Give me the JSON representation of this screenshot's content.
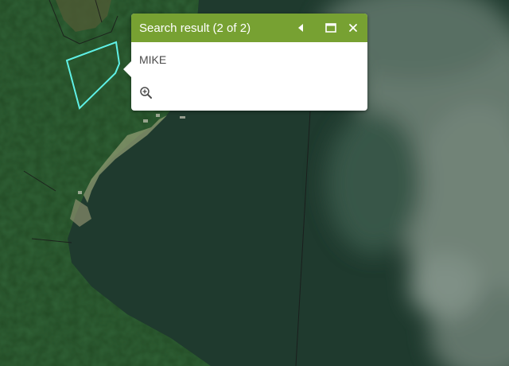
{
  "popup": {
    "title": "Search result (2 of 2)",
    "content": "MIKE",
    "previous_icon": "triangle-left-icon",
    "maximize_icon": "maximize-icon",
    "close_icon": "close-x-icon",
    "zoom_icon": "zoom-in-magnifier-icon",
    "header_color": "#77a132"
  },
  "map": {
    "basemap": "satellite imagery",
    "highlight_color": "#5ff0e6",
    "line_color": "#1a1a1a"
  }
}
